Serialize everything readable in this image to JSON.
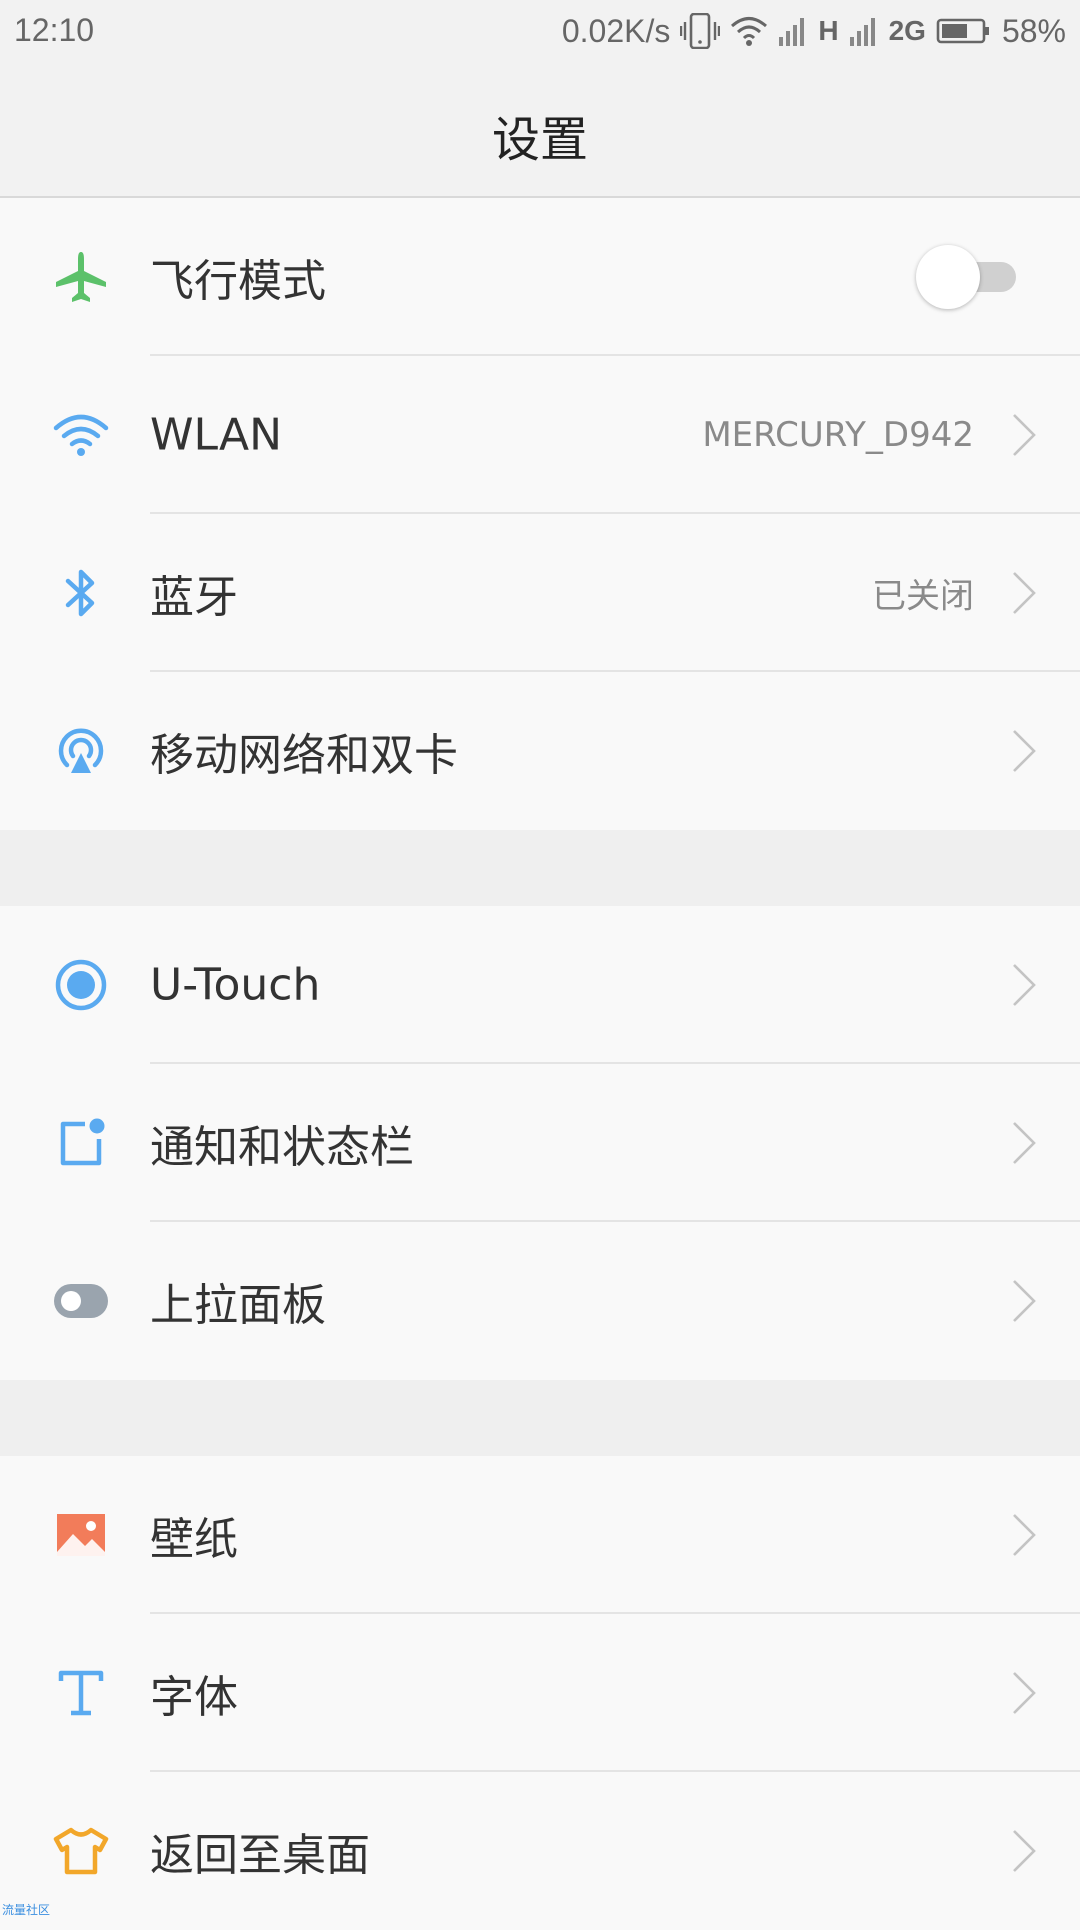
{
  "status_bar": {
    "time": "12:10",
    "net_speed": "0.02K/s",
    "network_type_1": "H",
    "network_type_2": "2G",
    "battery": "58%"
  },
  "header": {
    "title": "设置"
  },
  "sections": [
    {
      "items": [
        {
          "label": "飞行模式",
          "icon": "airplane-icon",
          "toggle": "off"
        },
        {
          "label": "WLAN",
          "value": "MERCURY_D942",
          "icon": "wifi-icon"
        },
        {
          "label": "蓝牙",
          "value": "已关闭",
          "icon": "bluetooth-icon"
        },
        {
          "label": "移动网络和双卡",
          "icon": "mobile-network-icon"
        }
      ]
    },
    {
      "items": [
        {
          "label": "U-Touch",
          "icon": "u-touch-icon"
        },
        {
          "label": "通知和状态栏",
          "icon": "notification-icon"
        },
        {
          "label": "上拉面板",
          "icon": "toggle-panel-icon"
        }
      ]
    },
    {
      "items": [
        {
          "label": "壁纸",
          "icon": "wallpaper-icon"
        },
        {
          "label": "字体",
          "icon": "font-icon"
        },
        {
          "label": "返回至桌面",
          "icon": "tshirt-icon"
        }
      ]
    }
  ],
  "watermark": "流量社区",
  "colors": {
    "airplane": "#5cc16a",
    "blue": "#5aaaf0",
    "gray_icon": "#9aa4ae",
    "wallpaper": "#f27c5a",
    "theme": "#f2a72a"
  }
}
